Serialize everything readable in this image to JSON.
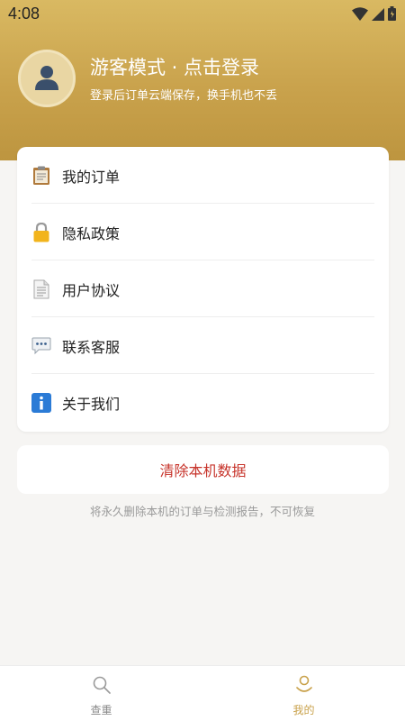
{
  "status_bar": {
    "time": "4:08",
    "icons": [
      "wifi-icon",
      "signal-icon",
      "battery-icon"
    ]
  },
  "profile": {
    "title": "游客模式 · 点击登录",
    "subtitle": "登录后订单云端保存，换手机也不丢",
    "avatar_icon": "user-icon"
  },
  "menu": {
    "items": [
      {
        "label": "我的订单",
        "icon": "clipboard-icon"
      },
      {
        "label": "隐私政策",
        "icon": "lock-icon"
      },
      {
        "label": "用户协议",
        "icon": "document-icon"
      },
      {
        "label": "联系客服",
        "icon": "speech-bubble-icon"
      },
      {
        "label": "关于我们",
        "icon": "info-icon"
      }
    ]
  },
  "clear_data": {
    "button_label": "清除本机数据",
    "note": "将永久删除本机的订单与检测报告，不可恢复"
  },
  "tabbar": {
    "tabs": [
      {
        "label": "查重",
        "icon": "search-icon",
        "active": false
      },
      {
        "label": "我的",
        "icon": "smile-user-icon",
        "active": true
      }
    ]
  },
  "colors": {
    "header_gradient_top": "#d9b962",
    "header_gradient_bottom": "#bd953f",
    "accent": "#c9a24c",
    "danger": "#c7342b",
    "page_background": "#f6f5f3"
  }
}
